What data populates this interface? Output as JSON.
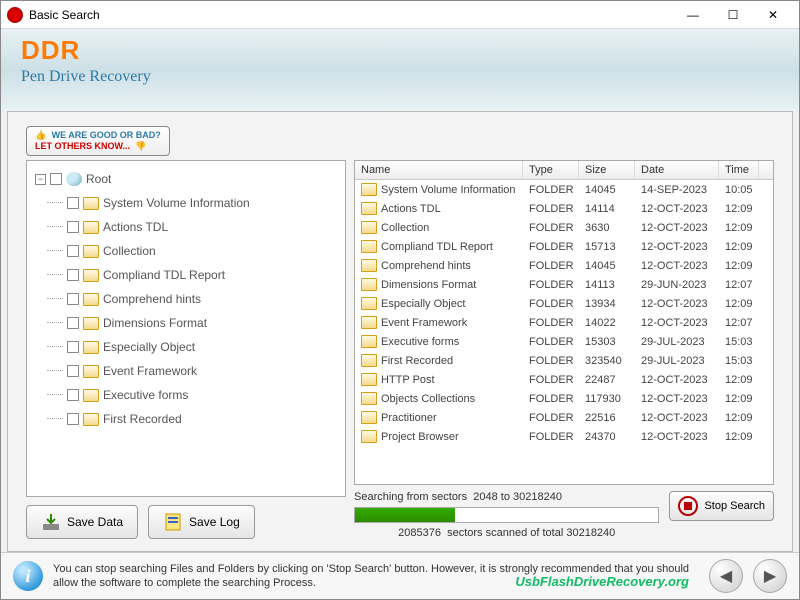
{
  "window": {
    "title": "Basic Search"
  },
  "banner": {
    "brand": "DDR",
    "subtitle": "Pen Drive Recovery"
  },
  "feedback": {
    "line1": "WE ARE GOOD OR BAD?",
    "line2": "LET OTHERS KNOW..."
  },
  "tree": {
    "root": "Root",
    "items": [
      "System Volume Information",
      "Actions TDL",
      "Collection",
      "Compliand TDL Report",
      "Comprehend hints",
      "Dimensions Format",
      "Especially Object",
      "Event Framework",
      "Executive forms",
      "First Recorded"
    ]
  },
  "buttons": {
    "save_data": "Save Data",
    "save_log": "Save Log",
    "stop": "Stop Search"
  },
  "grid": {
    "headers": {
      "name": "Name",
      "type": "Type",
      "size": "Size",
      "date": "Date",
      "time": "Time"
    },
    "rows": [
      {
        "name": "System Volume Information",
        "type": "FOLDER",
        "size": "14045",
        "date": "14-SEP-2023",
        "time": "10:05"
      },
      {
        "name": "Actions TDL",
        "type": "FOLDER",
        "size": "14114",
        "date": "12-OCT-2023",
        "time": "12:09"
      },
      {
        "name": "Collection",
        "type": "FOLDER",
        "size": "3630",
        "date": "12-OCT-2023",
        "time": "12:09"
      },
      {
        "name": "Compliand TDL Report",
        "type": "FOLDER",
        "size": "15713",
        "date": "12-OCT-2023",
        "time": "12:09"
      },
      {
        "name": "Comprehend hints",
        "type": "FOLDER",
        "size": "14045",
        "date": "12-OCT-2023",
        "time": "12:09"
      },
      {
        "name": "Dimensions Format",
        "type": "FOLDER",
        "size": "14113",
        "date": "29-JUN-2023",
        "time": "12:07"
      },
      {
        "name": "Especially Object",
        "type": "FOLDER",
        "size": "13934",
        "date": "12-OCT-2023",
        "time": "12:09"
      },
      {
        "name": "Event Framework",
        "type": "FOLDER",
        "size": "14022",
        "date": "12-OCT-2023",
        "time": "12:07"
      },
      {
        "name": "Executive forms",
        "type": "FOLDER",
        "size": "15303",
        "date": "29-JUL-2023",
        "time": "15:03"
      },
      {
        "name": "First Recorded",
        "type": "FOLDER",
        "size": "323540",
        "date": "29-JUL-2023",
        "time": "15:03"
      },
      {
        "name": "HTTP Post",
        "type": "FOLDER",
        "size": "22487",
        "date": "12-OCT-2023",
        "time": "12:09"
      },
      {
        "name": "Objects Collections",
        "type": "FOLDER",
        "size": "117930",
        "date": "12-OCT-2023",
        "time": "12:09"
      },
      {
        "name": "Practitioner",
        "type": "FOLDER",
        "size": "22516",
        "date": "12-OCT-2023",
        "time": "12:09"
      },
      {
        "name": "Project Browser",
        "type": "FOLDER",
        "size": "24370",
        "date": "12-OCT-2023",
        "time": "12:09"
      }
    ]
  },
  "progress": {
    "label_prefix": "Searching from sectors",
    "range": "2048 to 30218240",
    "scanned": "2085376",
    "total": "30218240",
    "status_mid": "sectors scanned of total"
  },
  "footer": {
    "hint": "You can stop searching Files and Folders by clicking on 'Stop Search' button. However, it is strongly recommended that you should allow the software to complete the searching Process.",
    "site": "UsbFlashDriveRecovery.org"
  }
}
